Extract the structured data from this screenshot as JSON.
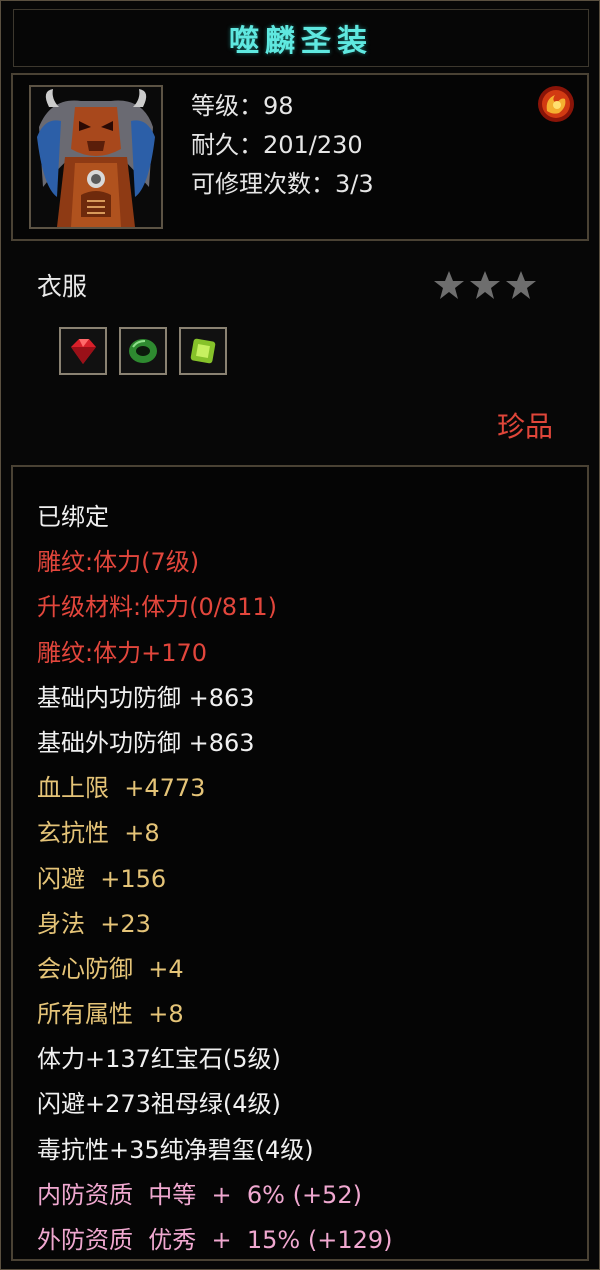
{
  "item": {
    "name": "噬麟圣装",
    "level_text": "等级：98",
    "durability_text": "耐久：201/230",
    "repair_text": "可修理次数：3/3",
    "type": "衣服",
    "stars": 3,
    "rarity": "珍品",
    "gems": [
      {
        "name": "ruby-gem-icon",
        "color": "#d8202a"
      },
      {
        "name": "jade-ring-gem-icon",
        "color": "#3fae3a"
      },
      {
        "name": "emerald-gem-icon",
        "color": "#a8dc3c"
      }
    ]
  },
  "colors": {
    "title": "#5fe8e0",
    "red": "#e2463c",
    "gold": "#e5c478",
    "white": "#f0f0f0",
    "pink": "#f0a8d0"
  },
  "attributes": [
    {
      "text": "已绑定",
      "color": "white"
    },
    {
      "text": "雕纹:体力(7级)",
      "color": "red"
    },
    {
      "text": "升级材料:体力(0/811)",
      "color": "red"
    },
    {
      "text": "雕纹:体力+170",
      "color": "red"
    },
    {
      "text": "基础内功防御 +863",
      "color": "white"
    },
    {
      "text": "基础外功防御 +863",
      "color": "white"
    },
    {
      "text": "血上限  +4773",
      "color": "gold"
    },
    {
      "text": "玄抗性  +8",
      "color": "gold"
    },
    {
      "text": "闪避  +156",
      "color": "gold"
    },
    {
      "text": "身法  +23",
      "color": "gold"
    },
    {
      "text": "会心防御  +4",
      "color": "gold"
    },
    {
      "text": "所有属性  +8",
      "color": "gold"
    },
    {
      "text": "体力+137红宝石(5级)",
      "color": "white"
    },
    {
      "text": "闪避+273祖母绿(4级)",
      "color": "white"
    },
    {
      "text": "毒抗性+35纯净碧玺(4级)",
      "color": "white"
    },
    {
      "text": "内防资质  中等  +  6% (+52)",
      "color": "pink"
    },
    {
      "text": "外防资质  优秀  +  15% (+129)",
      "color": "pink"
    }
  ]
}
